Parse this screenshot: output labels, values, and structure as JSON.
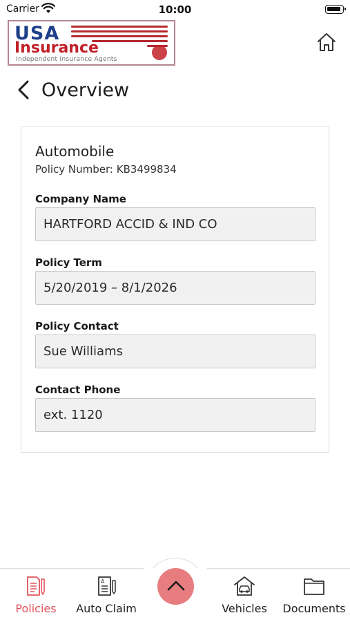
{
  "status_bar": {
    "carrier": "Carrier",
    "time": "10:00"
  },
  "header": {
    "logo": {
      "line1": "USA",
      "line2": "Insurance",
      "tagline": "Independent Insurance Agents"
    },
    "home_icon": "home-icon",
    "back_icon": "chevron-left-icon",
    "title": "Overview"
  },
  "policy": {
    "type": "Automobile",
    "number_text": "Policy Number: KB3499834",
    "fields": [
      {
        "label": "Company Name",
        "value": "HARTFORD ACCID & IND CO"
      },
      {
        "label": "Policy Term",
        "value": "5/20/2019 – 8/1/2026"
      },
      {
        "label": "Policy Contact",
        "value": "Sue Williams"
      },
      {
        "label": "Contact Phone",
        "value": "ext. 1120"
      }
    ]
  },
  "bottom_nav": {
    "items": [
      {
        "label": "Policies",
        "icon": "policies-icon",
        "active": true
      },
      {
        "label": "Auto Claim",
        "icon": "auto-claim-icon",
        "active": false
      },
      {
        "label": "Vehicles",
        "icon": "vehicles-icon",
        "active": false
      },
      {
        "label": "Documents",
        "icon": "documents-icon",
        "active": false
      }
    ],
    "center_icon": "chevron-up-icon"
  },
  "colors": {
    "accent": "#e1545c",
    "center_button": "#e87d7f",
    "logo_blue": "#1e3f8a",
    "logo_red": "#c12028"
  }
}
